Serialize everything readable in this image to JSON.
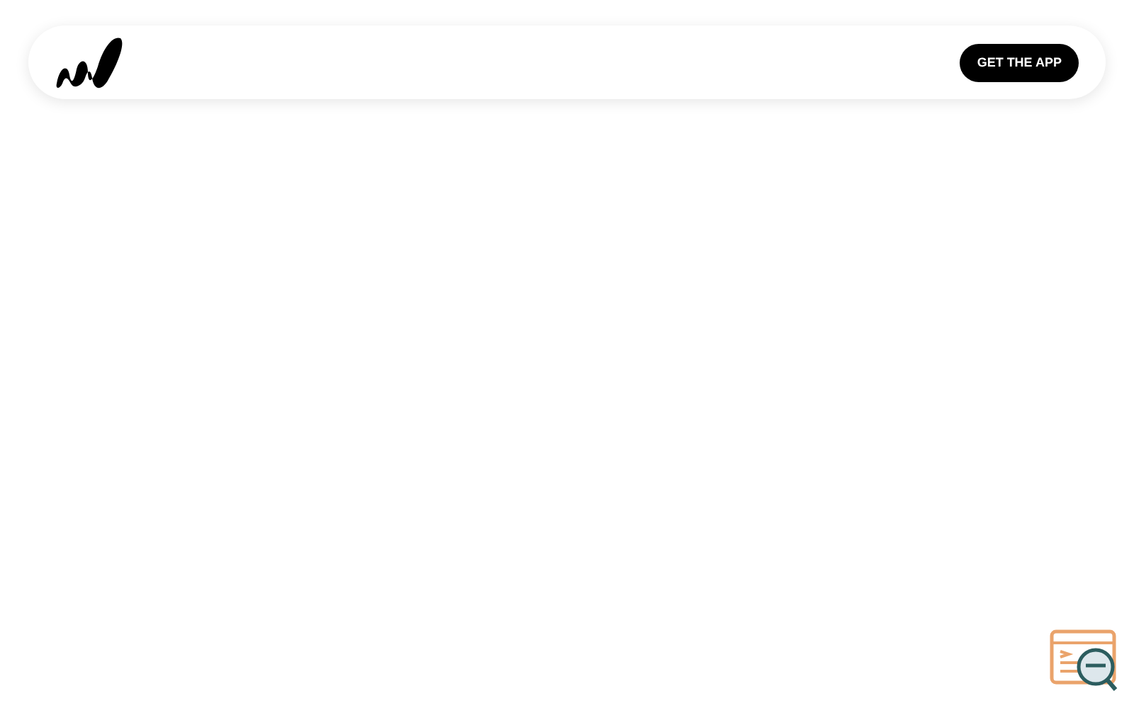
{
  "header": {
    "button": "GET THE APP"
  }
}
